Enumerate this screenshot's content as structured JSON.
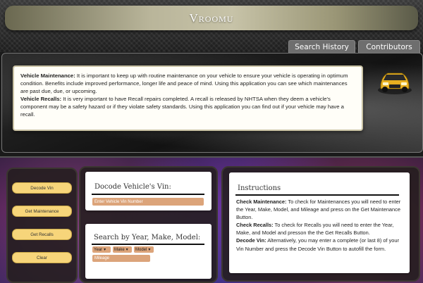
{
  "header": {
    "title": "Vroomu"
  },
  "nav": {
    "history_label": "Search History",
    "contributors_label": "Contributors"
  },
  "info": {
    "maintenance_heading": "Vehicle Maintenance:",
    "maintenance_text": " It is important to keep up with routine maintenance on your vehicle to ensure your vehicle is operating in optimum condition. Benefits include improved performance, longer life and peace of mind. Using this application you can see which maintenances are past due, due, or upcoming.",
    "recalls_heading": "Vehicle Recalls:",
    "recalls_text": " It is very important to have Recall repairs completed. A recall is released by NHTSA when they deem a vehicle's component may be a safety hazard or if they violate safety standards. Using this application you can find out if your vehicle may have a recall."
  },
  "actions": {
    "decode_label": "Decode Vin",
    "maintenance_label": "Get Maintenance",
    "recalls_label": "Get Recalls",
    "clear_label": "Clear"
  },
  "decode": {
    "heading": "Docode Vehicle's Vin:",
    "placeholder": "Enter Vehicle Vin Number"
  },
  "search": {
    "heading": "Search by Year, Make, Model:",
    "year_label": "Year",
    "make_label": "Make",
    "model_label": "Model",
    "mileage_placeholder": "Mileage"
  },
  "instructions": {
    "heading": "Instructions",
    "maintenance_heading": "Check Maintenance:",
    "maintenance_text": " To check for Maintenances you will need to enter the Year, Make, Model, and Mileage and press on the Get Maintenance Button.",
    "recalls_heading": "Check Recalls:",
    "recalls_text": " To check for Recalls you will need to enter the Year, Make, and Model and presson the the Get Recalls Button.",
    "decode_heading": "Decode Vin:",
    "decode_text": " Alternatively, you may enter a complete (or last 8) of your Vin Number and press the Decode Vin Button to autofill the form."
  },
  "colors": {
    "button": "#f7d57a",
    "input": "#dca47a",
    "car": "#e8b020"
  }
}
